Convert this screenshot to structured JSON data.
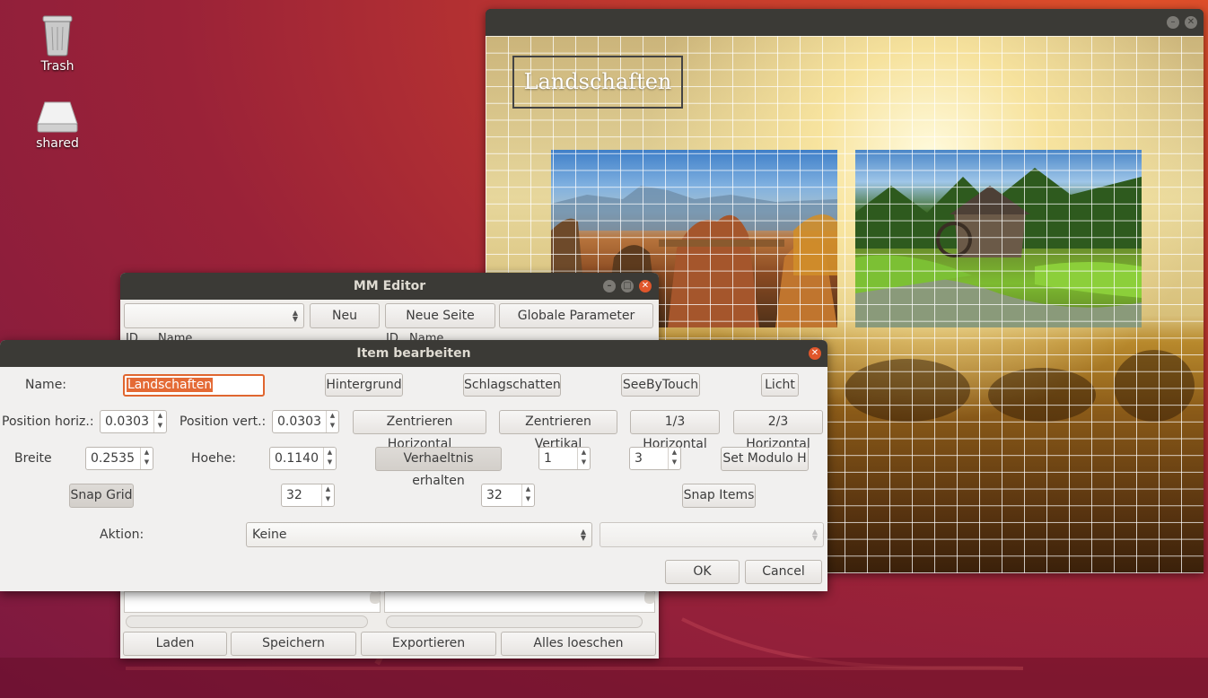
{
  "desktop": {
    "icons": [
      {
        "label": "Trash",
        "icon": "trash-icon"
      },
      {
        "label": "shared",
        "icon": "drive-icon"
      }
    ]
  },
  "preview": {
    "slide_title": "Landschaften",
    "photos": [
      "sandstone-bridge-photo",
      "water-mill-photo"
    ]
  },
  "mm_editor": {
    "title": "MM Editor",
    "toolbar": {
      "combo_value": "",
      "new_label": "Neu",
      "new_page_label": "Neue Seite",
      "global_params_label": "Globale Parameter"
    },
    "columns": {
      "left_id": "ID",
      "left_name": "Name",
      "right_id": "ID",
      "right_name": "Name"
    },
    "footer": {
      "load_label": "Laden",
      "save_label": "Speichern",
      "export_label": "Exportieren",
      "delete_all_label": "Alles loeschen"
    }
  },
  "dialog": {
    "title": "Item bearbeiten",
    "name_label": "Name:",
    "name_value": "Landschaften",
    "hintergrund_label": "Hintergrund",
    "schlagschatten_label": "Schlagschatten",
    "seebytouch_label": "SeeByTouch",
    "licht_label": "Licht",
    "pos_h_label": "Position horiz.:",
    "pos_h_value": "0.0303",
    "pos_v_label": "Position vert.:",
    "pos_v_value": "0.0303",
    "center_h_label": "Zentrieren Horizontal",
    "center_v_label": "Zentrieren Vertikal",
    "third_h_label": "1/3 Horizontal",
    "two_third_h_label": "2/3 Horizontal",
    "breite_label": "Breite",
    "breite_value": "0.2535",
    "hoehe_label": "Hoehe:",
    "hoehe_value": "0.1140",
    "keep_ratio_label": "Verhaeltnis erhalten",
    "ratio_a_value": "1",
    "ratio_b_value": "3",
    "set_modulo_label": "Set Modulo H",
    "snap_grid_label": "Snap Grid",
    "grid_x_value": "32",
    "grid_y_value": "32",
    "snap_items_label": "Snap Items",
    "aktion_label": "Aktion:",
    "aktion_value": "Keine",
    "aktion_target_value": "",
    "ok_label": "OK",
    "cancel_label": "Cancel"
  },
  "colors": {
    "titlebar": "#3b3a36",
    "close_button": "#e0562b",
    "selection": "#e46a35"
  }
}
